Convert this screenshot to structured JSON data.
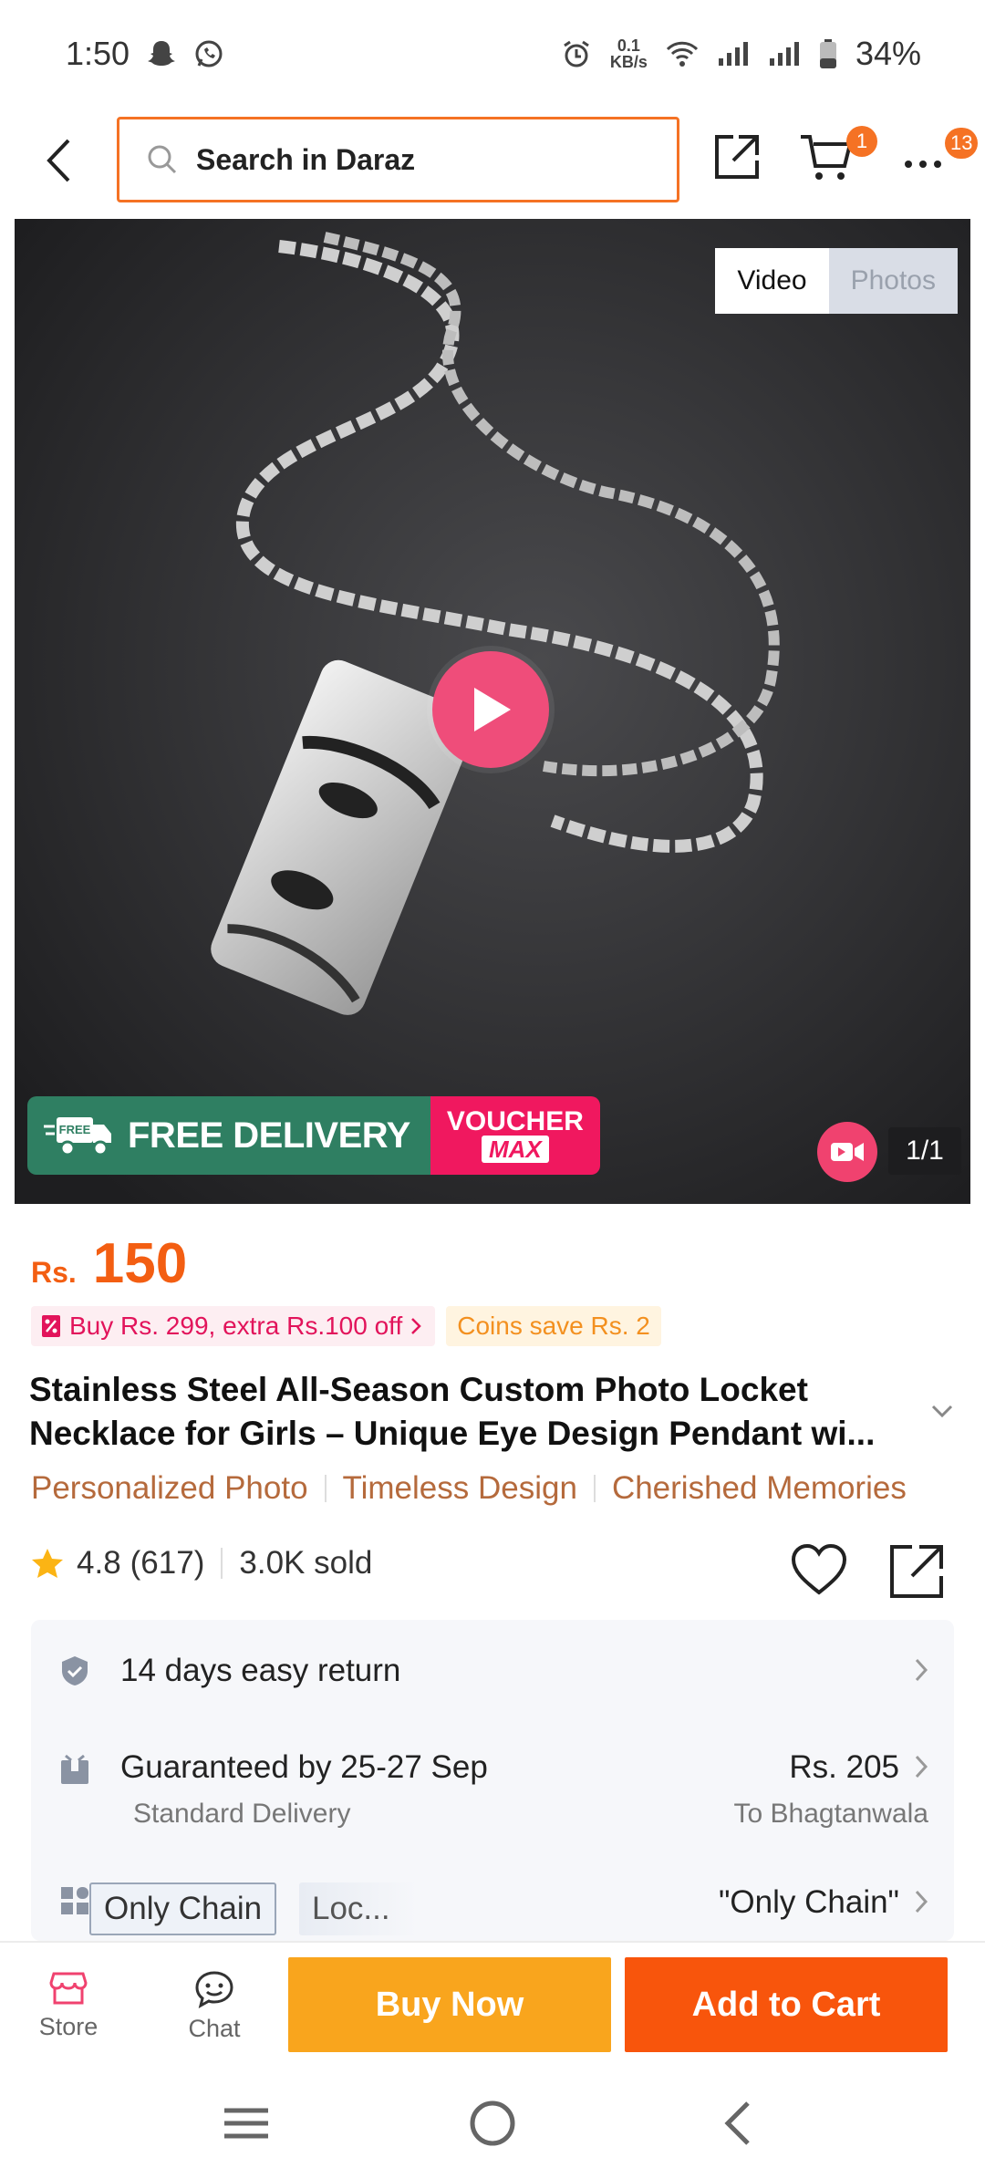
{
  "status_bar": {
    "time": "1:50",
    "net_speed_top": "0.1",
    "net_speed_bottom": "KB/s",
    "battery": "34%"
  },
  "header": {
    "search_placeholder": "Search in Daraz",
    "cart_badge": "1",
    "more_badge": "13"
  },
  "media": {
    "tabs": [
      {
        "label": "Video",
        "active": true
      },
      {
        "label": "Photos",
        "active": false
      }
    ],
    "free_delivery": "FREE DELIVERY",
    "free_tag": "FREE",
    "voucher_top": "VOUCHER",
    "voucher_bottom": "MAX",
    "counter": "1/1"
  },
  "product": {
    "currency": "Rs.",
    "price": "150",
    "promo_offer": "Buy Rs. 299, extra Rs.100 off",
    "coins": "Coins save Rs. 2",
    "title": "Stainless Steel All-Season Custom Photo Locket Necklace for Girls – Unique Eye Design Pendant wi...",
    "tags": [
      "Personalized Photo",
      "Timeless Design",
      "Cherished Memories"
    ],
    "rating": "4.8",
    "reviews": "(617)",
    "sold": "3.0K sold"
  },
  "services": {
    "return": "14 days easy return",
    "delivery_guarantee": "Guaranteed by 25-27 Sep",
    "delivery_type": "Standard Delivery",
    "delivery_price": "Rs. 205",
    "delivery_to": "To Bhagtanwala",
    "variant_selected": "Only Chain",
    "variant_other": "Loc...",
    "variant_summary": "\"Only Chain\""
  },
  "action_bar": {
    "store": "Store",
    "chat": "Chat",
    "buy_now": "Buy Now",
    "add_to_cart": "Add to Cart"
  },
  "colors": {
    "accent": "#f57224",
    "buy_now": "#f9a51d",
    "add_to_cart": "#f8550c",
    "price": "#f35e12"
  }
}
